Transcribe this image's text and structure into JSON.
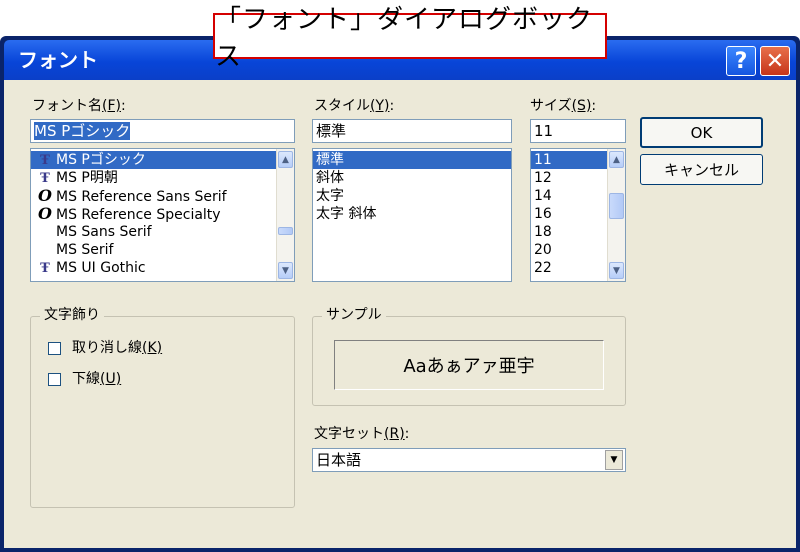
{
  "caption": "「フォント」ダイアログボックス",
  "window": {
    "title": "フォント",
    "help": "?",
    "close": "✕"
  },
  "font_name": {
    "label": "フォント名",
    "accel": "(F)",
    "colon": ":",
    "value": "MS Pゴシック",
    "items": [
      {
        "icon": "truetype-icon",
        "glyph": "Ŧ",
        "name": "MS Pゴシック",
        "selected": true
      },
      {
        "icon": "truetype-icon",
        "glyph": "Ŧ",
        "name": "MS P明朝",
        "selected": false
      },
      {
        "icon": "opentype-icon",
        "glyph": "O",
        "name": "MS Reference Sans Serif",
        "selected": false
      },
      {
        "icon": "opentype-icon",
        "glyph": "O",
        "name": "MS Reference Specialty",
        "selected": false
      },
      {
        "icon": "",
        "glyph": "",
        "name": "MS Sans Serif",
        "selected": false
      },
      {
        "icon": "",
        "glyph": "",
        "name": "MS Serif",
        "selected": false
      },
      {
        "icon": "truetype-icon",
        "glyph": "Ŧ",
        "name": "MS UI Gothic",
        "selected": false
      }
    ]
  },
  "style": {
    "label": "スタイル",
    "accel": "(Y)",
    "colon": ":",
    "value": "標準",
    "items": [
      "標準",
      "斜体",
      "太字",
      "太字 斜体"
    ]
  },
  "size": {
    "label": "サイズ",
    "accel": "(S)",
    "colon": ":",
    "value": "11",
    "items": [
      "11",
      "12",
      "14",
      "16",
      "18",
      "20",
      "22"
    ]
  },
  "buttons": {
    "ok": "OK",
    "cancel": "キャンセル"
  },
  "effects": {
    "legend": "文字飾り",
    "strike": {
      "label": "取り消し線",
      "accel": "(K)"
    },
    "underline": {
      "label": "下線",
      "accel": "(U)"
    }
  },
  "sample": {
    "legend": "サンプル",
    "text": "Aaあぁアァ亜宇"
  },
  "charset": {
    "label": "文字セット",
    "accel": "(R)",
    "colon": ":",
    "value": "日本語"
  },
  "colors": {
    "title_bar": "#0845d8",
    "selection": "#316ac5",
    "dialog_bg": "#ece9d8",
    "caption_border": "#d40000"
  }
}
